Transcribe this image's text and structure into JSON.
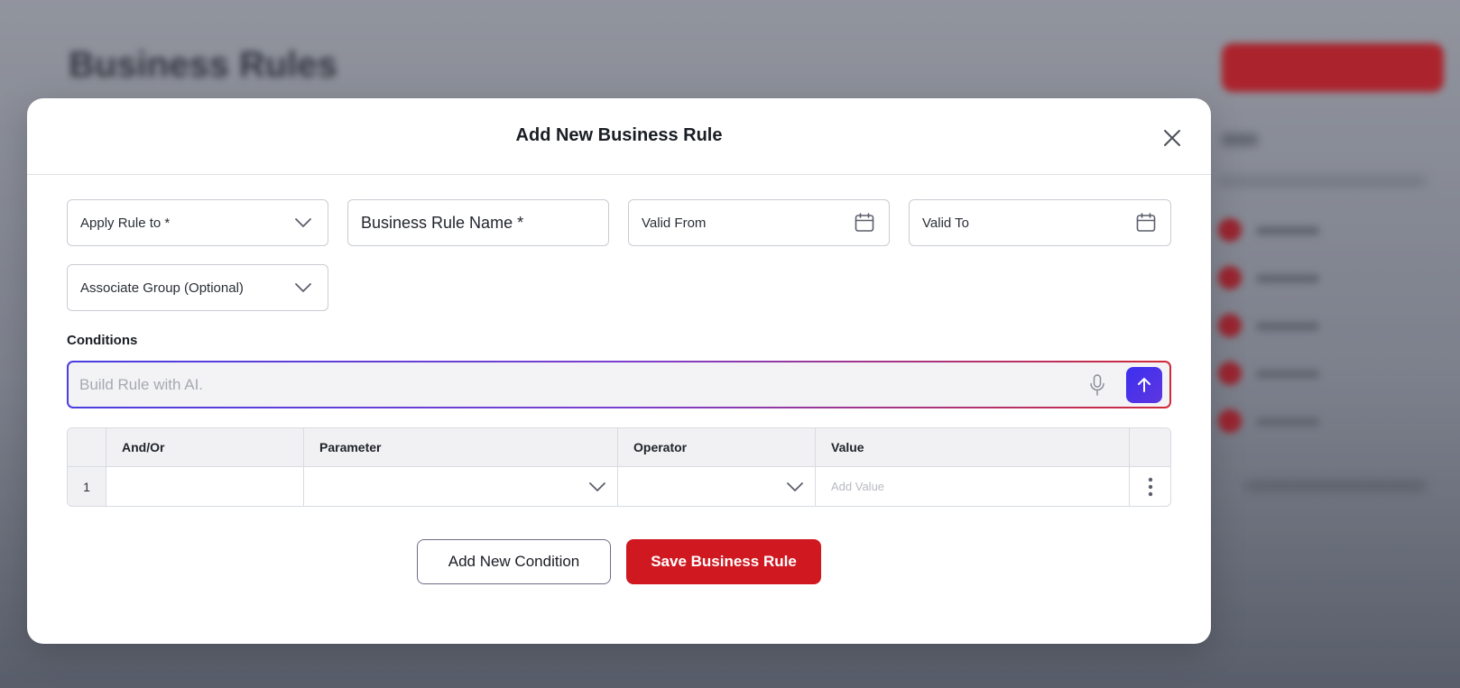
{
  "background": {
    "page_title": "Business Rules"
  },
  "modal": {
    "title": "Add New Business Rule",
    "close_icon": "close-icon"
  },
  "form": {
    "apply_rule_to": "Apply Rule to *",
    "business_rule_name": "Business Rule Name *",
    "valid_from": "Valid From",
    "valid_to": "Valid To",
    "associate_group": "Associate Group (Optional)"
  },
  "conditions": {
    "label": "Conditions",
    "ai_placeholder": "Build Rule with AI.",
    "mic_icon": "microphone-icon",
    "send_icon": "arrow-up-icon"
  },
  "grid": {
    "columns": [
      "",
      "And/Or",
      "Parameter",
      "Operator",
      "Value",
      ""
    ],
    "rows": [
      {
        "index": "1",
        "and_or": "",
        "parameter": "",
        "operator": "",
        "value_placeholder": "Add Value"
      }
    ]
  },
  "actions": {
    "add_condition": "Add New Condition",
    "save": "Save Business Rule"
  },
  "colors": {
    "primary": "#cf1820",
    "accent": "#3c2ff0"
  }
}
